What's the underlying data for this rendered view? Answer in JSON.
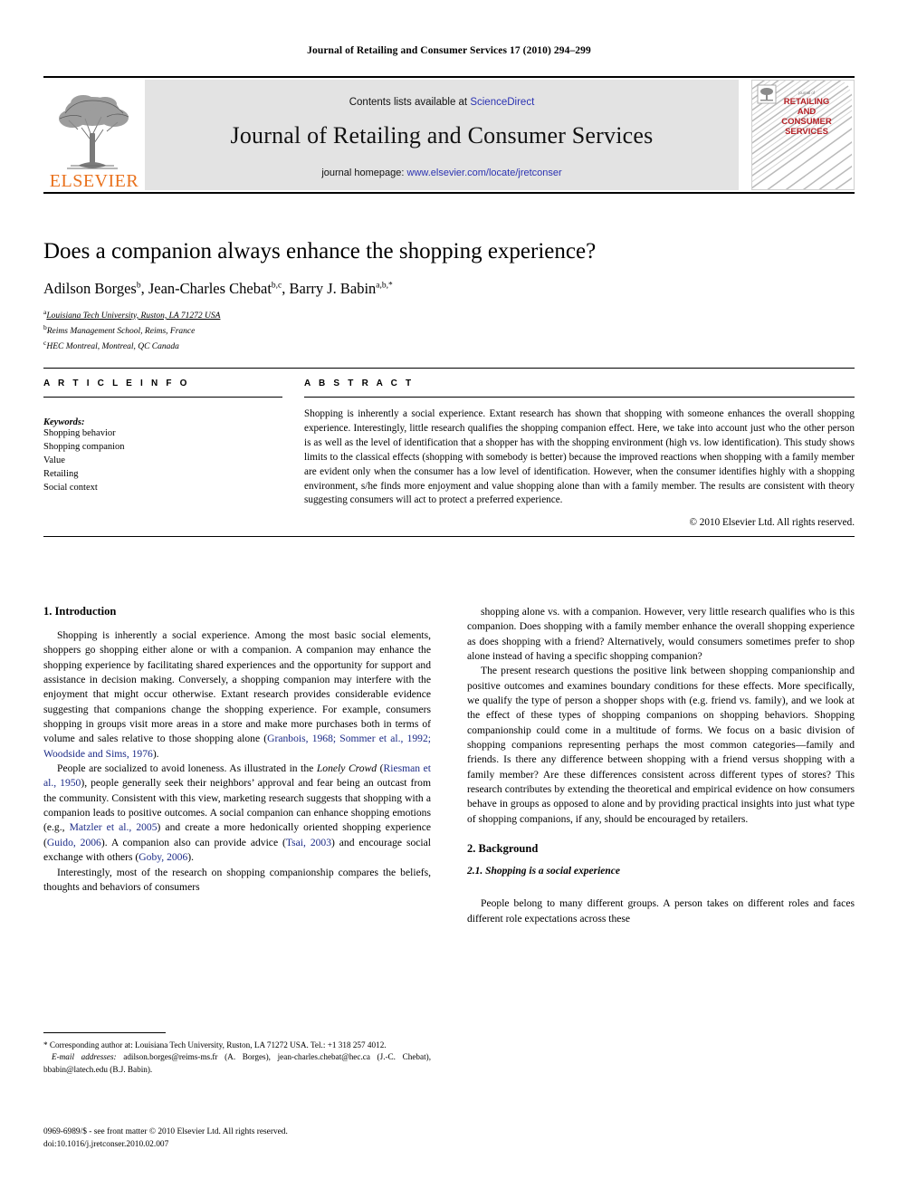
{
  "running_head": "Journal of Retailing and Consumer Services 17 (2010) 294–299",
  "masthead": {
    "contents_prefix": "Contents lists available at ",
    "sciencedirect": "ScienceDirect",
    "journal_title": "Journal of Retailing and Consumer Services",
    "homepage_prefix": "journal homepage: ",
    "homepage_url": "www.elsevier.com/locate/jretconser",
    "publisher_wordmark": "ELSEVIER",
    "cover": {
      "kicker": "journal of",
      "line1": "RETAILING",
      "line2": "AND",
      "line3": "CONSUMER",
      "line4": "SERVICES"
    },
    "colors": {
      "link": "#2b32b2",
      "elsevier_orange": "#E9711C",
      "band_grey": "#e3e3e3",
      "cover_red": "#b51f24"
    }
  },
  "article": {
    "title": "Does a companion always enhance the shopping experience?",
    "authors": [
      {
        "name": "Adilson Borges",
        "sup": "b"
      },
      {
        "name": "Jean-Charles Chebat",
        "sup": "b,c"
      },
      {
        "name": "Barry J. Babin",
        "sup": "a,b,*"
      }
    ],
    "affiliations": [
      {
        "marker": "a",
        "text": "Louisiana Tech University, Ruston, LA 71272 USA"
      },
      {
        "marker": "b",
        "text": "Reims Management School, Reims, France"
      },
      {
        "marker": "c",
        "text": "HEC Montreal, Montreal, QC Canada"
      }
    ]
  },
  "article_info": {
    "heading": "A R T I C L E   I N F O",
    "keywords_label": "Keywords:",
    "keywords": [
      "Shopping behavior",
      "Shopping companion",
      "Value",
      "Retailing",
      "Social context"
    ]
  },
  "abstract": {
    "heading": "A B S T R A C T",
    "text": "Shopping is inherently a social experience. Extant research has shown that shopping with someone enhances the overall shopping experience. Interestingly, little research qualifies the shopping companion effect. Here, we take into account just who the other person is as well as the level of identification that a shopper has with the shopping environment (high vs. low identification). This study shows limits to the classical effects (shopping with somebody is better) because the improved reactions when shopping with a family member are evident only when the consumer has a low level of identification. However, when the consumer identifies highly with a shopping environment, s/he finds more enjoyment and value shopping alone than with a family member. The results are consistent with theory suggesting consumers will act to protect a preferred experience.",
    "copyright": "© 2010 Elsevier Ltd. All rights reserved."
  },
  "sections": {
    "introduction_heading": "1. Introduction",
    "background_heading": "2. Background",
    "background_sub_heading": "2.1. Shopping is a social experience"
  },
  "body": {
    "left": {
      "p1_a": "Shopping is inherently a social experience. Among the most basic social elements, shoppers go shopping either alone or with a companion. A companion may enhance the shopping experience by facilitating shared experiences and the opportunity for support and assistance in decision making. Conversely, a shopping companion may interfere with the enjoyment that might occur otherwise. Extant research provides considerable evidence suggesting that companions change the shopping experience. For example, consumers shopping in groups visit more areas in a store and make more purchases both in terms of volume and sales relative to those shopping alone (",
      "p1_cite": "Granbois, 1968; Sommer et al., 1992; Woodside and Sims, 1976",
      "p1_b": ").",
      "p2_a": "People are socialized to avoid loneness. As illustrated in the ",
      "p2_italic": "Lonely Crowd",
      "p2_b": " (",
      "p2_cite1": "Riesman et al., 1950",
      "p2_c": "), people generally seek their neighbors’ approval and fear being an outcast from the community. Consistent with this view, marketing research suggests that shopping with a companion leads to positive outcomes. A social companion can enhance shopping emotions (e.g., ",
      "p2_cite2": "Matzler et al., 2005",
      "p2_d": ") and create a more hedonically oriented shopping experience (",
      "p2_cite3": "Guido, 2006",
      "p2_e": "). A companion also can provide advice (",
      "p2_cite4": "Tsai, 2003",
      "p2_f": ") and encourage social exchange with others (",
      "p2_cite5": "Goby, 2006",
      "p2_g": ").",
      "p3": "Interestingly, most of the research on shopping companionship compares the beliefs, thoughts and behaviors of consumers"
    },
    "right": {
      "p1": "shopping alone vs. with a companion. However, very little research qualifies who is this companion. Does shopping with a family member enhance the overall shopping experience as does shopping with a friend? Alternatively, would consumers sometimes prefer to shop alone instead of having a specific shopping companion?",
      "p2": "The present research questions the positive link between shopping companionship and positive outcomes and examines boundary conditions for these effects. More specifically, we qualify the type of person a shopper shops with (e.g. friend vs. family), and we look at the effect of these types of shopping companions on shopping behaviors. Shopping companionship could come in a multitude of forms. We focus on a basic division of shopping companions representing perhaps the most common categories—family and friends. Is there any difference between shopping with a friend versus shopping with a family member? Are these differences consistent across different types of stores? This research contributes by extending the theoretical and empirical evidence on how consumers behave in groups as opposed to alone and by providing practical insights into just what type of shopping companions, if any, should be encouraged by retailers.",
      "p3": "People belong to many different groups. A person takes on different roles and faces different role expectations across these"
    }
  },
  "footnotes": {
    "corresponding": "* Corresponding author at: Louisiana Tech University, Ruston, LA 71272 USA. Tel.: +1 318 257 4012.",
    "email_label": "E-mail addresses:",
    "emails": "adilson.borges@reims-ms.fr (A. Borges), jean-charles.chebat@hec.ca (J.-C. Chebat), bbabin@latech.edu (B.J. Babin)."
  },
  "imprint": {
    "line1": "0969-6989/$ - see front matter © 2010 Elsevier Ltd. All rights reserved.",
    "line2": "doi:10.1016/j.jretconser.2010.02.007"
  }
}
